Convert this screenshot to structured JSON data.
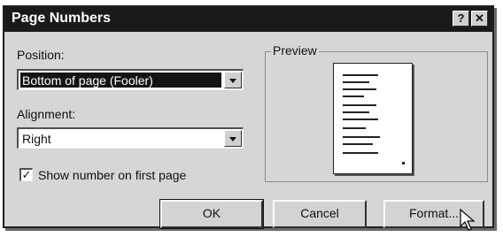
{
  "title": "Page Numbers",
  "titlebar_buttons": {
    "help": "?",
    "close": "✕"
  },
  "position": {
    "label": "Position:",
    "value": "Bottom of page (Fooler)"
  },
  "alignment": {
    "label": "Alignment:",
    "value": "Right"
  },
  "first_page_checkbox": {
    "label": "Show number on first page",
    "checked": true,
    "mark": "✓"
  },
  "preview": {
    "label": "Preview"
  },
  "buttons": {
    "ok": "OK",
    "cancel": "Cancel",
    "format": "Format..."
  }
}
